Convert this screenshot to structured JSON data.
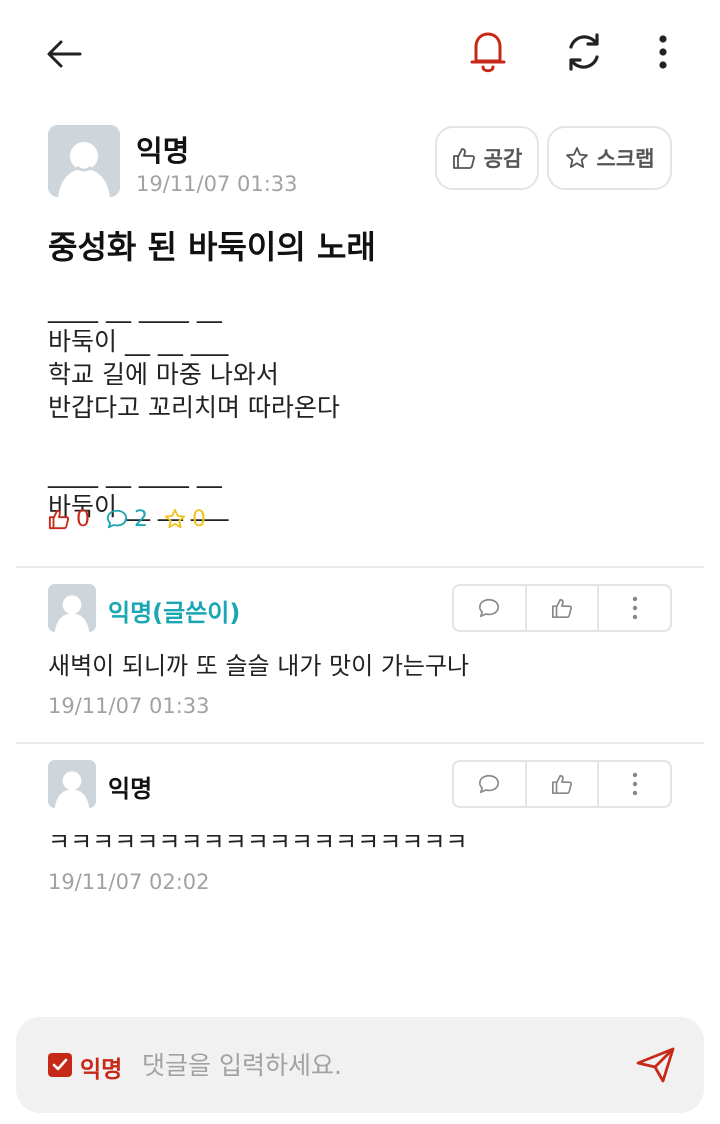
{
  "colors": {
    "accent": "#c62917",
    "teal": "#1aa7b3",
    "star": "#f1c21b",
    "muted": "#a2a2a2"
  },
  "toolbar": {
    "icons": [
      "back-arrow-icon",
      "bell-icon",
      "refresh-icon",
      "more-vertical-icon"
    ]
  },
  "post": {
    "author": "익명",
    "time": "19/11/07 01:33",
    "like_label": "공감",
    "scrap_label": "스크랩",
    "title": "중성화 된 바둑이의 노래",
    "body_lines": [
      "____ __ ____ __",
      "바둑이 __ __ ___",
      "학교 길에 마중 나와서",
      "반갑다고 꼬리치며 따라온다",
      "",
      "____ __ ____ __",
      "바둑이 __ __ ___"
    ],
    "stats": {
      "likes": "0",
      "comments": "2",
      "scraps": "0"
    }
  },
  "comments": [
    {
      "author": "익명(글쓴이)",
      "text": "새벽이 되니까 또 슬슬 내가 맛이 가는구나",
      "time": "19/11/07 01:33"
    },
    {
      "author": "익명",
      "text": "ㅋㅋㅋㅋㅋㅋㅋㅋㅋㅋㅋㅋㅋㅋㅋㅋㅋㅋㅋ",
      "time": "19/11/07 02:02"
    }
  ],
  "composer": {
    "anonymous_label": "익명",
    "anonymous_checked": true,
    "placeholder": "댓글을 입력하세요.",
    "value": ""
  }
}
